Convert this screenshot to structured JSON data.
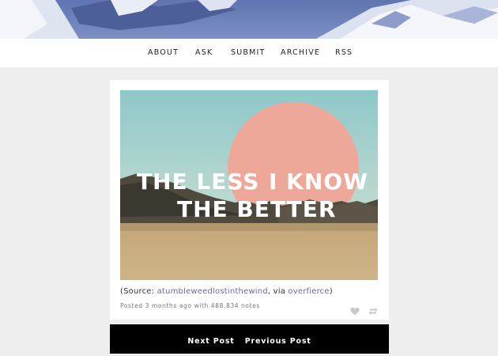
{
  "nav": {
    "items": [
      {
        "label": "ABOUT"
      },
      {
        "label": "ASK"
      },
      {
        "label": "SUBMIT"
      },
      {
        "label": "ARCHIVE"
      },
      {
        "label": "RSS"
      }
    ]
  },
  "post": {
    "image_text": {
      "line1_part1": "THE LESS",
      "line1_part2": "I KNOW",
      "line2": "THE BETTER"
    },
    "source": {
      "prefix": "(Source: ",
      "source_link": "atumbleweedlostinthewind",
      "separator": ", via ",
      "via_link": "overfierce",
      "suffix": ")"
    },
    "meta": "Posted 3 months ago with 488,834 notes",
    "actions": {
      "like_icon": "heart-icon",
      "reblog_icon": "reblog-icon"
    }
  },
  "pagination": {
    "next_label": "Next Post",
    "previous_label": "Previous Post"
  },
  "colors": {
    "page_bg": "#eeeeee",
    "card_bg": "#ffffff",
    "pagination_bg": "#000000",
    "link": "#6b6b9a",
    "sun": "#eea89a"
  }
}
